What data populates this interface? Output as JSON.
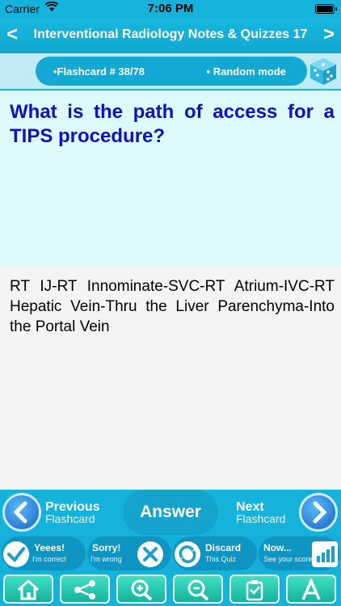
{
  "status_bar": {
    "carrier": "Carrier",
    "time": "7:06 PM"
  },
  "title_bar": {
    "back": "<",
    "title": "Interventional Radiology Notes & Quizzes 17",
    "forward": ">"
  },
  "info": {
    "flashcard": "•Flashcard #  38/78",
    "mode": "• Random mode"
  },
  "question": "What is the path of access for a TIPS procedure?",
  "answer": "RT IJ-RT Innominate-SVC-RT Atrium-IVC-RT Hepatic Vein-Thru the Liver Parenchyma-Into the Portal Vein",
  "nav": {
    "previous": {
      "line1": "Previous",
      "line2": "Flashcard"
    },
    "answer": "Answer",
    "next": {
      "line1": "Next",
      "line2": "Flashcard"
    }
  },
  "feedback": {
    "yes": {
      "title": "Yeees!",
      "sub": "I'm correct"
    },
    "sorry": {
      "title": "Sorry!",
      "sub": "I'm wrong"
    },
    "discard": {
      "title": "Discard",
      "sub": "This Quiz"
    },
    "now": {
      "title": "Now...",
      "sub": "See your score"
    }
  },
  "tools": [
    "home-icon",
    "share-icon",
    "zoom-in-icon",
    "zoom-out-icon",
    "clipboard-icon",
    "font-icon"
  ],
  "colors": {
    "header": "#15b3dc",
    "question_bg": "#ddfbfd",
    "question_text": "#1010cc",
    "tool_btn": "#2fd0b2"
  }
}
